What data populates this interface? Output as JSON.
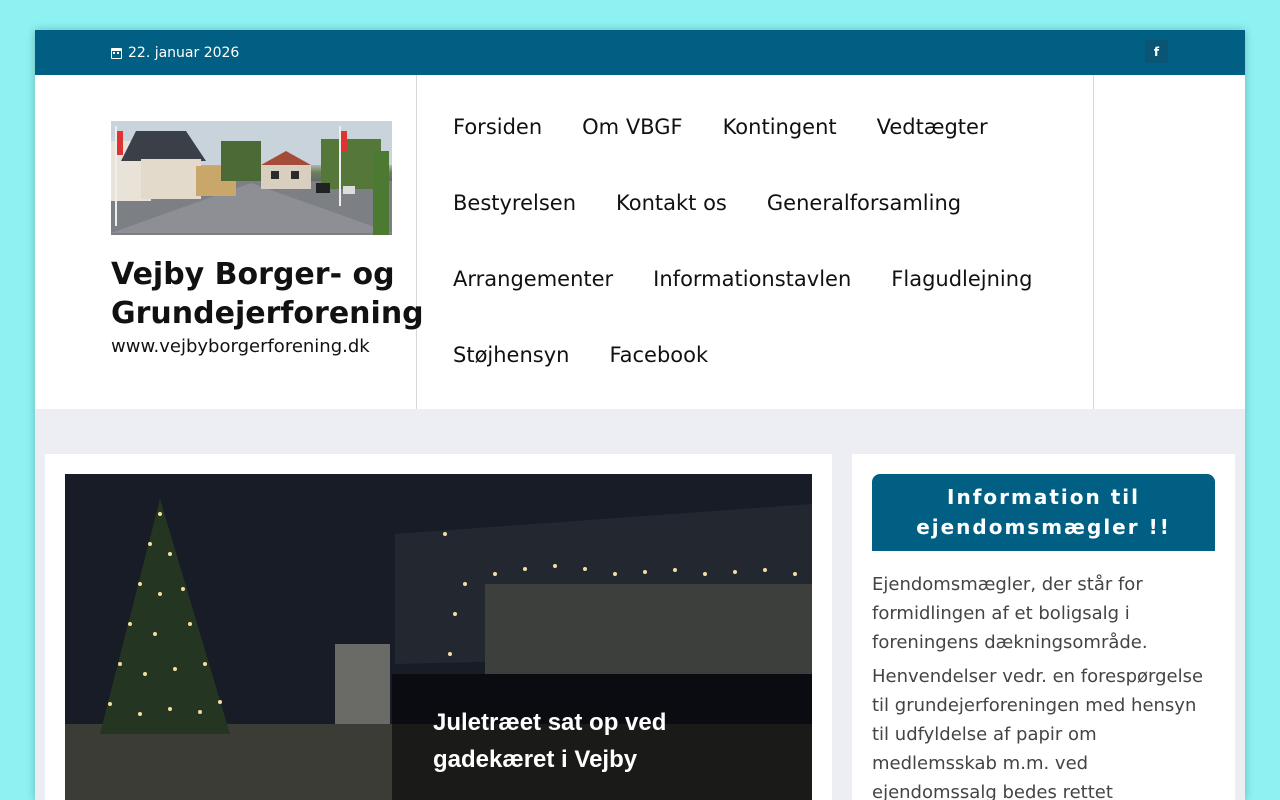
{
  "topbar": {
    "date": "22. januar 2026",
    "calendar_icon": "calendar-icon",
    "facebook_icon_glyph": "f"
  },
  "brand": {
    "title": "Vejby Borger- og Grundejerforening",
    "url": "www.vejbyborgerforening.dk"
  },
  "nav": {
    "rows": [
      [
        "Forsiden",
        "Om VBGF",
        "Kontingent",
        "Vedtægter"
      ],
      [
        "Bestyrelsen",
        "Kontakt os",
        "Generalforsamling"
      ],
      [
        "Arrangementer",
        "Informationstavlen",
        "Flagudlejning"
      ],
      [
        "Støjhensyn",
        "Facebook"
      ]
    ]
  },
  "featured": {
    "title": "Juletræet sat op ved gadekæret i Vejby"
  },
  "sidebar": {
    "heading": "Information til ejendomsmægler !!",
    "paragraphs": [
      "Ejendomsmægler, der står for formidlingen af et boligsalg i foreningens dækningsområde.",
      "Henvendelser vedr. en forespørgelse til grundejerforeningen med hensyn til udfyldelse af papir om medlemsskab m.m. ved ejendomssalg bedes rettet"
    ]
  },
  "colors": {
    "accent": "#005f83",
    "page_bg": "#8ef2f2"
  }
}
